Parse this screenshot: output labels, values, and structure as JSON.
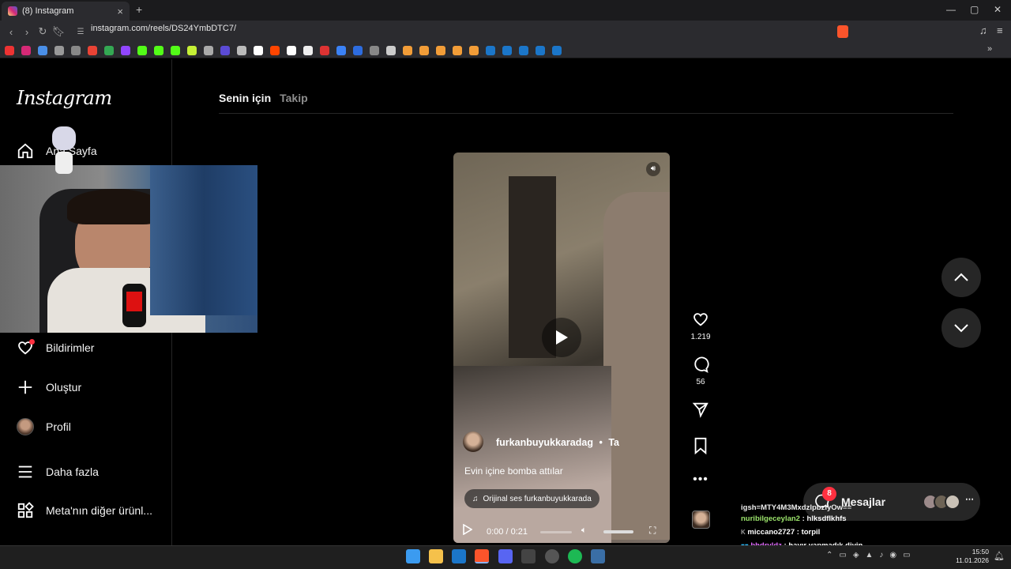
{
  "browser": {
    "tab_title": "(8) Instagram",
    "new_tab": "+",
    "url": "instagram.com/reels/DS24YmbDTC7/"
  },
  "sidebar": {
    "logo": "Instagram",
    "items": [
      {
        "label": "Ana Sayfa",
        "icon": "home-icon"
      },
      {
        "label": "Bildirimler",
        "icon": "heart-icon"
      },
      {
        "label": "Oluştur",
        "icon": "plus-icon"
      },
      {
        "label": "Profil",
        "icon": "avatar"
      },
      {
        "label": "Daha fazla",
        "icon": "menu-icon"
      },
      {
        "label": "Meta'nın diğer ürünl...",
        "icon": "grid-icon"
      }
    ]
  },
  "feed_tabs": {
    "for_you": "Senin için",
    "following": "Takip"
  },
  "reel": {
    "author": "furkanbuyukkaradag",
    "follow_hint": "Ta",
    "caption": "Evin içine bomba attılar",
    "audio": "Orijinal ses  furkanbuyukkarada",
    "time": "0:00 / 0:21",
    "progress": 0,
    "likes": "1.219",
    "comments": "56"
  },
  "messages": {
    "label": "Mesajlar",
    "badge": "8"
  },
  "chat_lines": [
    {
      "user": "",
      "text": "igsh=MTY4M3MxdzlpbzlyOw=="
    },
    {
      "user": "nuribilgeceylan2",
      "text": "hlksdflkhfs",
      "color": "#9be36b"
    },
    {
      "user": "miccano2727",
      "text": "torpil",
      "color": "#ffffff"
    },
    {
      "user": "bhdryldz",
      "text": "hayır yapmadık diyin",
      "color": "#e26bff"
    }
  ],
  "clock": {
    "time": "15:50",
    "date": "11.01.2026"
  },
  "colors": {
    "accent": "#ff3040",
    "bg": "#000000",
    "panel": "#262626"
  }
}
